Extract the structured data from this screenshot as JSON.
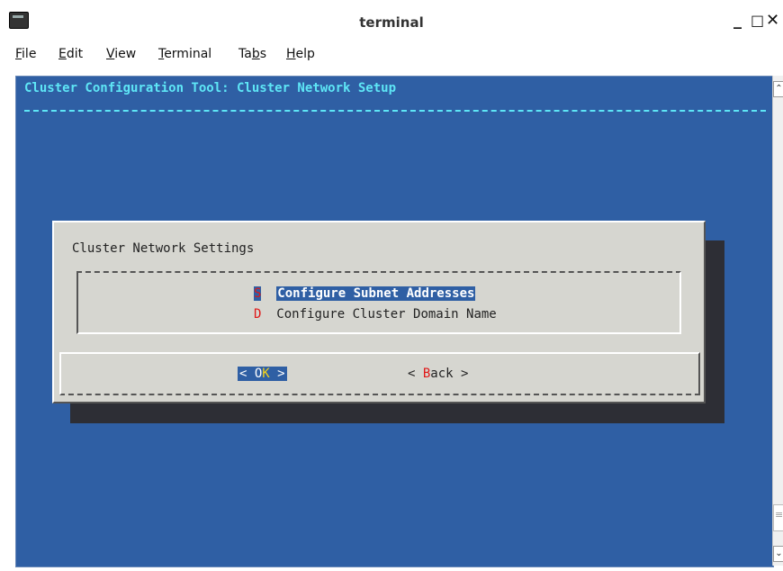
{
  "window": {
    "title": "terminal",
    "controls": {
      "minimize": "_",
      "maximize": "□",
      "close": "✕"
    }
  },
  "menu": [
    {
      "pre": "",
      "ul": "F",
      "post": "ile"
    },
    {
      "pre": "",
      "ul": "E",
      "post": "dit"
    },
    {
      "pre": "",
      "ul": "V",
      "post": "iew"
    },
    {
      "pre": "",
      "ul": "T",
      "post": "erminal"
    },
    {
      "pre": "Ta",
      "ul": "b",
      "post": "s"
    },
    {
      "pre": "",
      "ul": "H",
      "post": "elp"
    }
  ],
  "terminal": {
    "header": "Cluster Configuration Tool: Cluster Network Setup",
    "colors": {
      "background": "#2f5fa4",
      "header": "#5ee6f6",
      "dialog": "#d6d6d0",
      "hotkey": "#e01818"
    }
  },
  "dialog": {
    "title": "Cluster Network Settings",
    "items": [
      {
        "hotkey": "S",
        "label": "Configure Subnet Addresses",
        "selected": true
      },
      {
        "hotkey": "D",
        "label": "Configure Cluster Domain Name",
        "selected": false
      }
    ],
    "buttons": {
      "ok": {
        "left": "< ",
        "pre": "O",
        "hotkey": "K",
        "right": " >"
      },
      "back": {
        "left": "< ",
        "hotkey": "B",
        "post": "ack",
        "right": " >"
      }
    }
  },
  "scrollbar": {
    "up": "⌃",
    "down": "⌄"
  }
}
